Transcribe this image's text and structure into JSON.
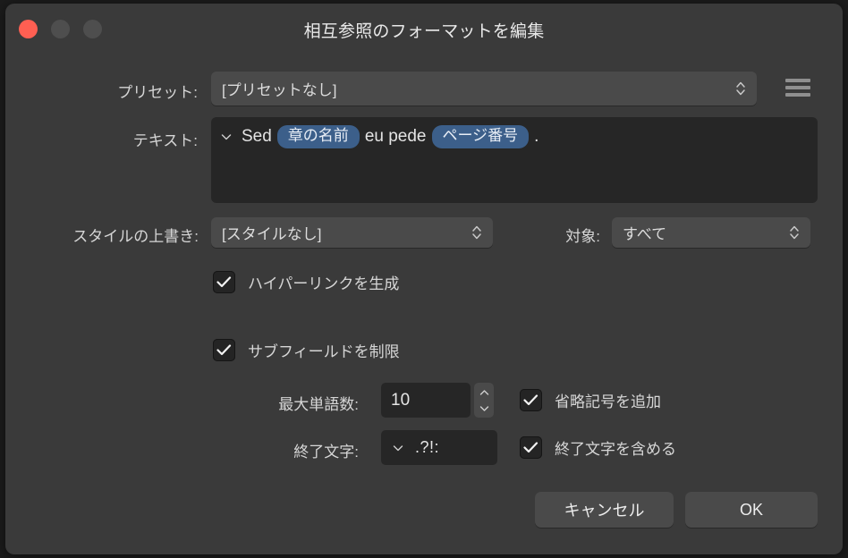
{
  "window": {
    "title": "相互参照のフォーマットを編集",
    "traffic_lights": [
      {
        "name": "close",
        "color": "#ff5f52",
        "active": true
      },
      {
        "name": "minimize",
        "color": "#4e4e4e",
        "active": false
      },
      {
        "name": "maximize",
        "color": "#4e4e4e",
        "active": false
      }
    ]
  },
  "preset": {
    "label": "プリセット:",
    "value": "[プリセットなし]",
    "menu_icon": "hamburger-menu-icon"
  },
  "text": {
    "label": "テキスト:",
    "disclosure_icon": "chevron-down-icon",
    "segments": [
      {
        "kind": "text",
        "value": "Sed"
      },
      {
        "kind": "token",
        "value": "章の名前"
      },
      {
        "kind": "text",
        "value": "eu pede"
      },
      {
        "kind": "token",
        "value": "ページ番号"
      },
      {
        "kind": "text",
        "value": "."
      }
    ],
    "token_color": "#3c5f8a"
  },
  "style_override": {
    "label": "スタイルの上書き:",
    "value": "[スタイルなし]"
  },
  "target": {
    "label": "対象:",
    "value": "すべて"
  },
  "hyperlink": {
    "label": "ハイパーリンクを生成",
    "checked": true
  },
  "subfield": {
    "label": "サブフィールドを制限",
    "checked": true
  },
  "max_words": {
    "label": "最大単語数:",
    "value": "10"
  },
  "ellipsis": {
    "label": "省略記号を追加",
    "checked": true
  },
  "terminator": {
    "label": "終了文字:",
    "value": ".?!:",
    "disclosure_icon": "chevron-down-icon"
  },
  "include_terminator": {
    "label": "終了文字を含める",
    "checked": true
  },
  "footer": {
    "cancel_label": "キャンセル",
    "ok_label": "OK"
  }
}
